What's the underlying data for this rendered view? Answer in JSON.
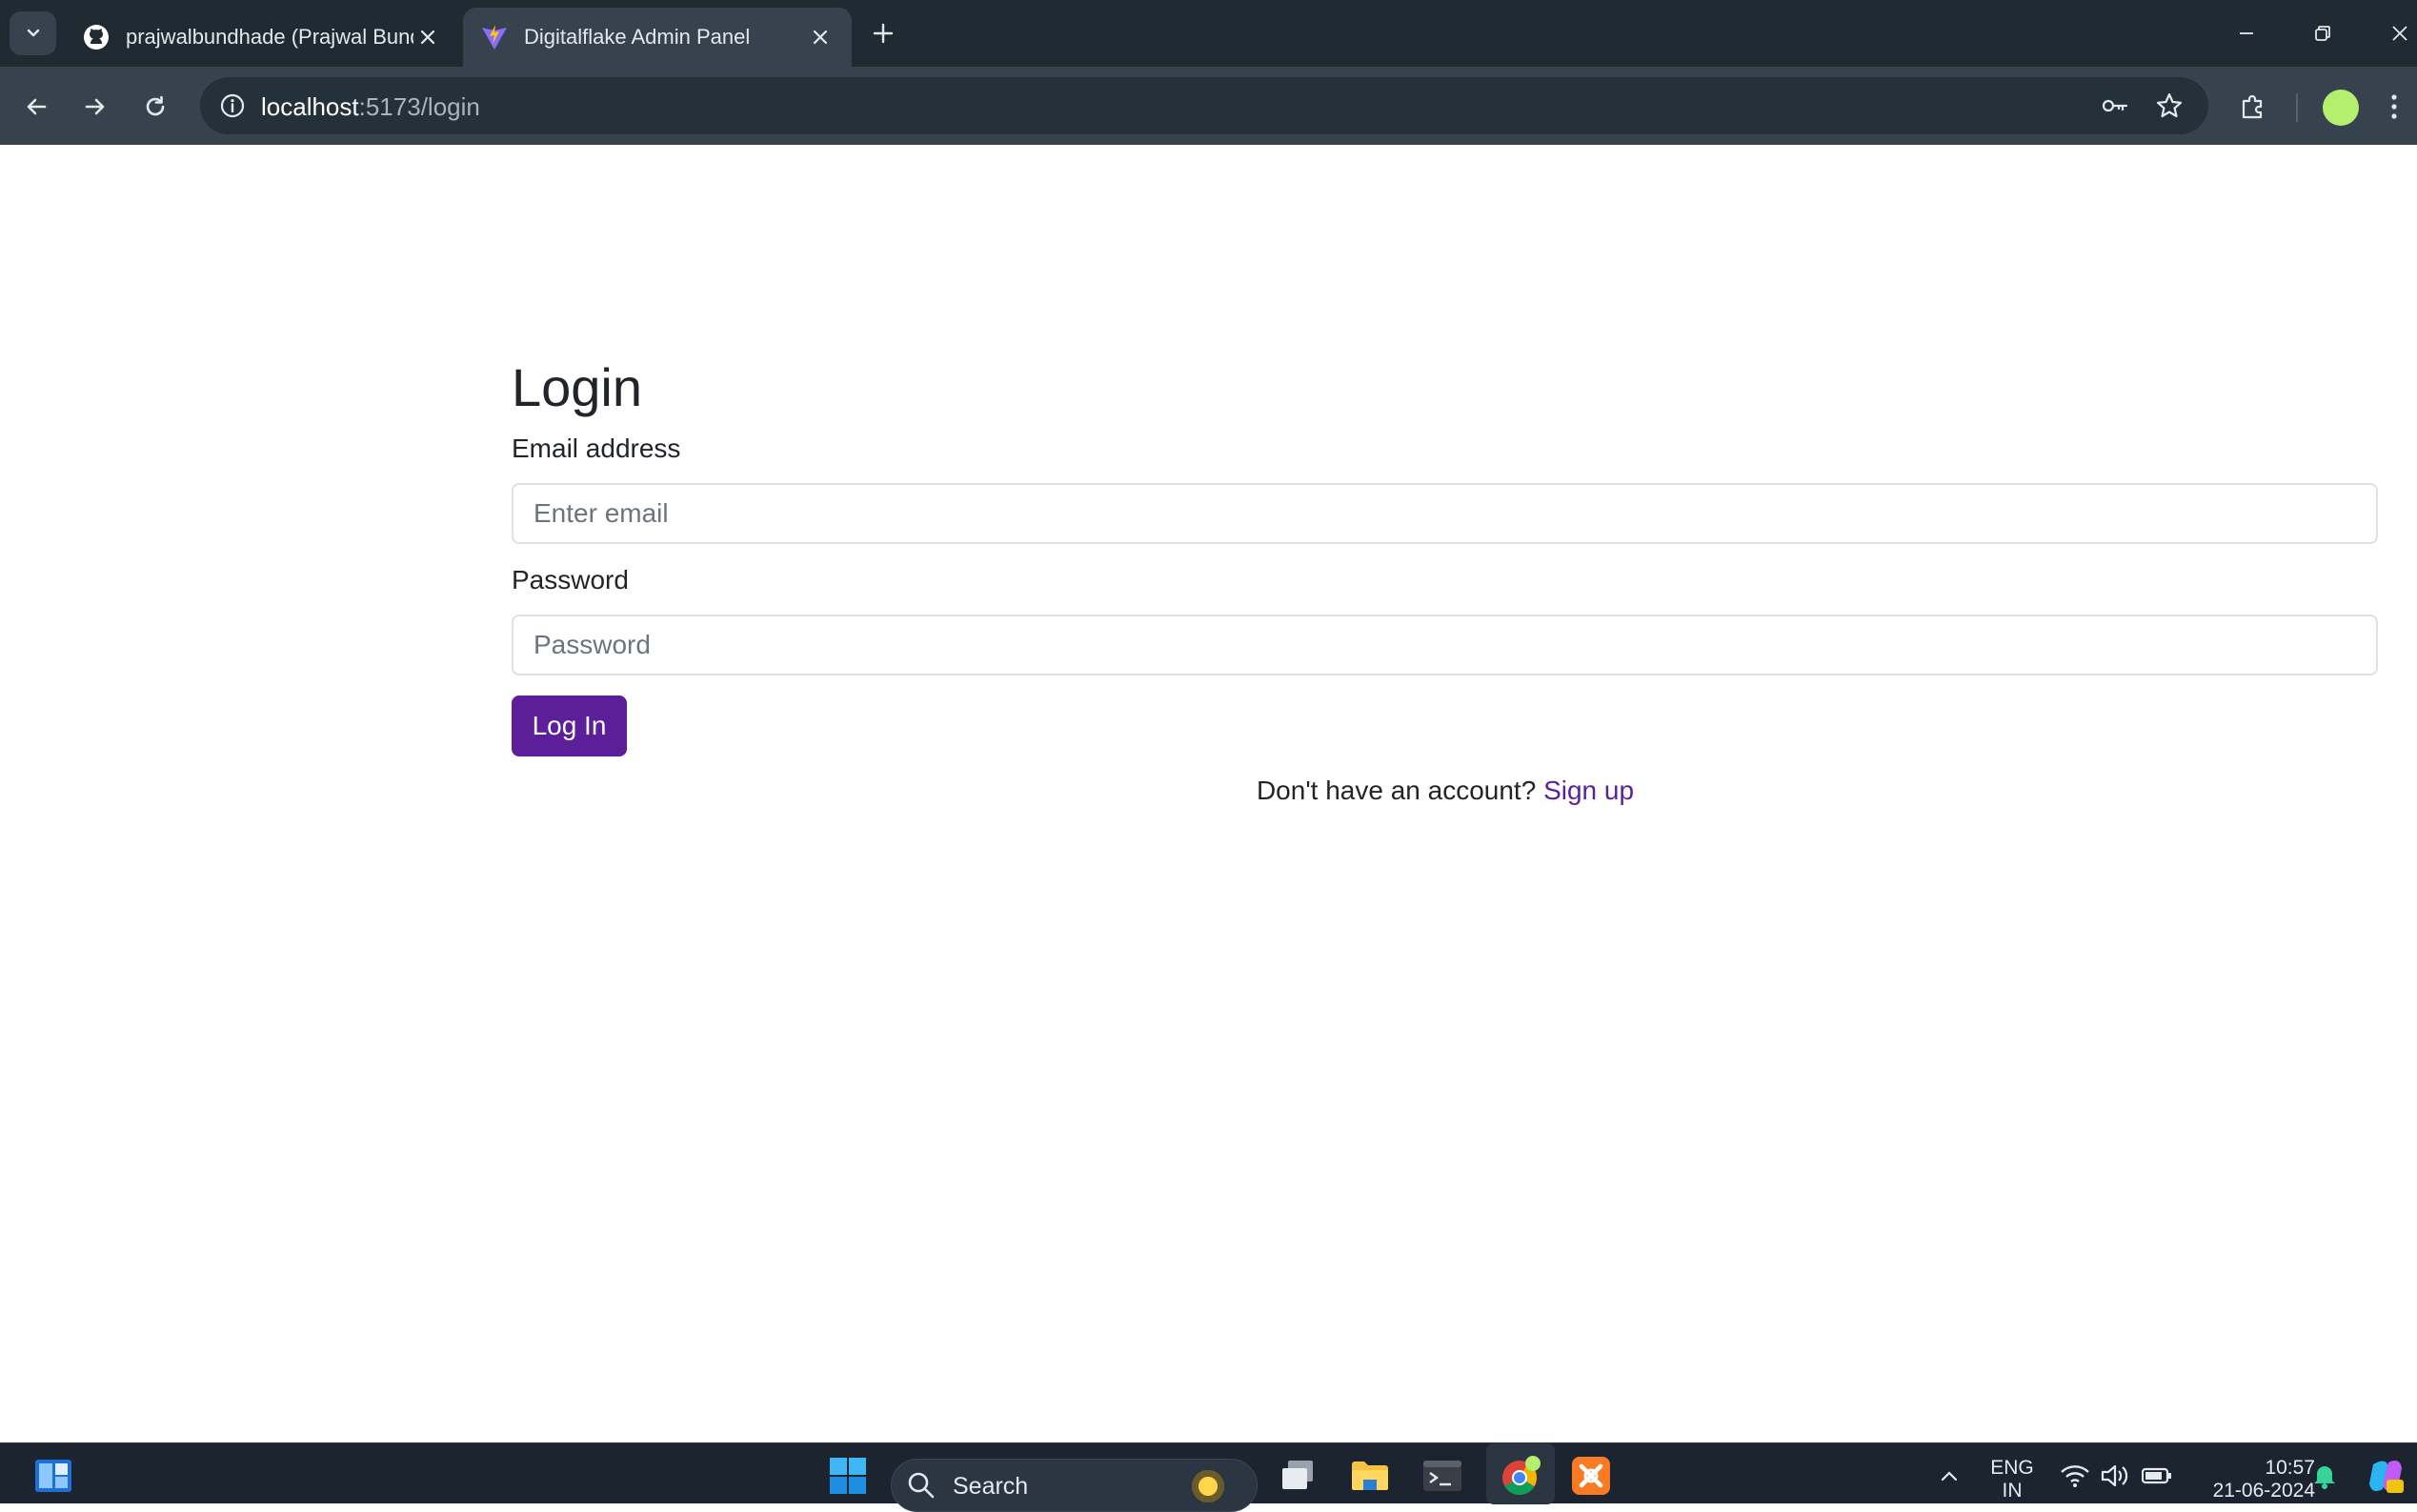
{
  "browser": {
    "tabs": [
      {
        "title": "prajwalbundhade (Prajwal Bundhade)",
        "icon": "github-icon",
        "active": false
      },
      {
        "title": "Digitalflake Admin Panel",
        "icon": "vite-icon",
        "active": true
      }
    ],
    "url": {
      "host": "localhost",
      "path": ":5173/login"
    }
  },
  "login": {
    "title": "Login",
    "email_label": "Email address",
    "email_placeholder": "Enter email",
    "password_label": "Password",
    "password_placeholder": "Password",
    "submit_label": "Log In",
    "signup_prompt": "Don't have an account?",
    "signup_link": "Sign up"
  },
  "colors": {
    "brand_purple": "#5c1f99",
    "tab_strip": "#1f2a33",
    "toolbar": "#36434e",
    "taskbar": "#1c2430"
  },
  "taskbar": {
    "search_label": "Search",
    "lang_line1": "ENG",
    "lang_line2": "IN",
    "time": "10:57",
    "date": "21-06-2024"
  }
}
